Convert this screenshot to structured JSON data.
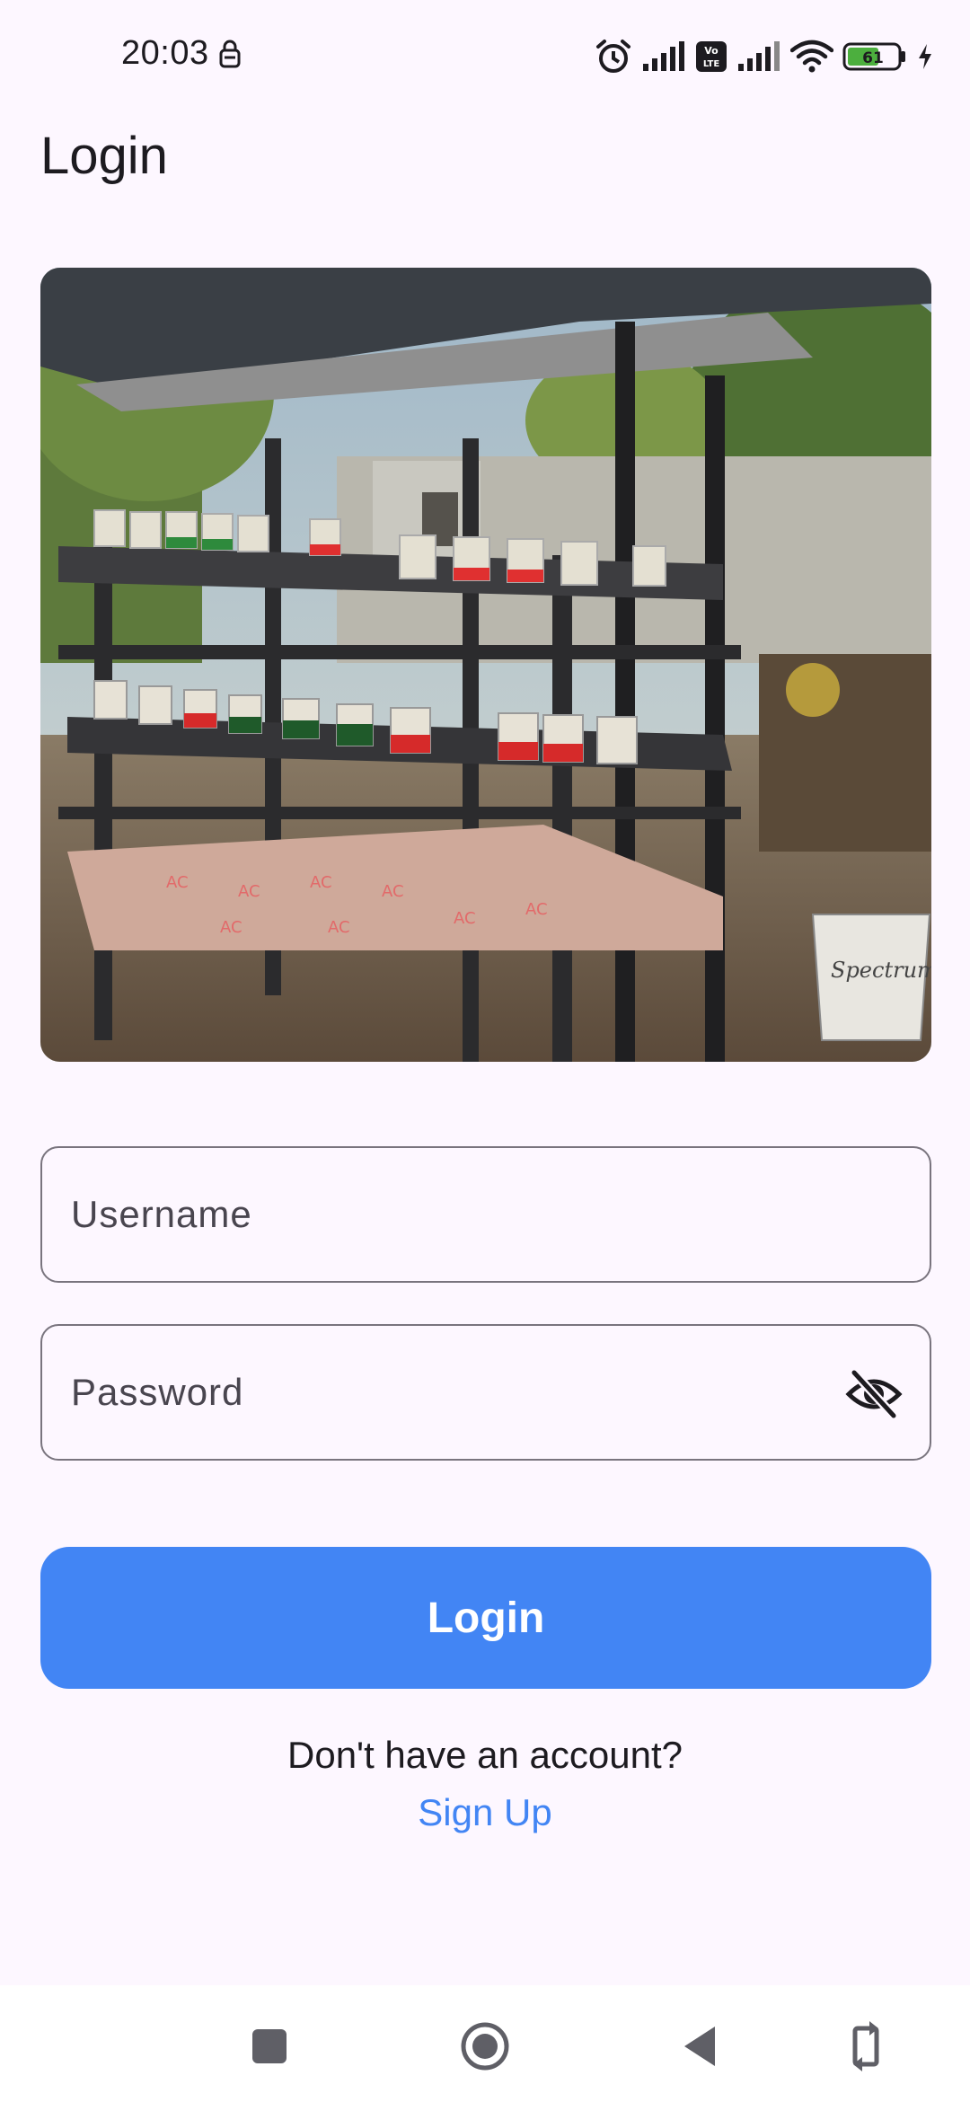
{
  "status_bar": {
    "time": "20:03",
    "battery_level": "61",
    "network_badge": "Vo LTE",
    "icons": [
      "lock-icon",
      "alarm-icon",
      "signal-icon",
      "volte-icon",
      "signal-icon",
      "wifi-icon",
      "battery-icon",
      "charging-icon"
    ]
  },
  "header": {
    "title": "Login"
  },
  "hero_image": {
    "sign_text": "Spectrum"
  },
  "form": {
    "username_placeholder": "Username",
    "password_placeholder": "Password",
    "password_toggle_icon": "visibility-off-icon"
  },
  "actions": {
    "login_label": "Login",
    "signup_prompt": "Don't have an account?",
    "signup_link": "Sign Up"
  },
  "colors": {
    "background": "#fdf7ff",
    "primary": "#4285f4",
    "outline": "#79747e",
    "text": "#1d1b20"
  },
  "nav_bar": {
    "icons": [
      "recents-icon",
      "home-icon",
      "back-icon",
      "rotate-icon"
    ]
  }
}
